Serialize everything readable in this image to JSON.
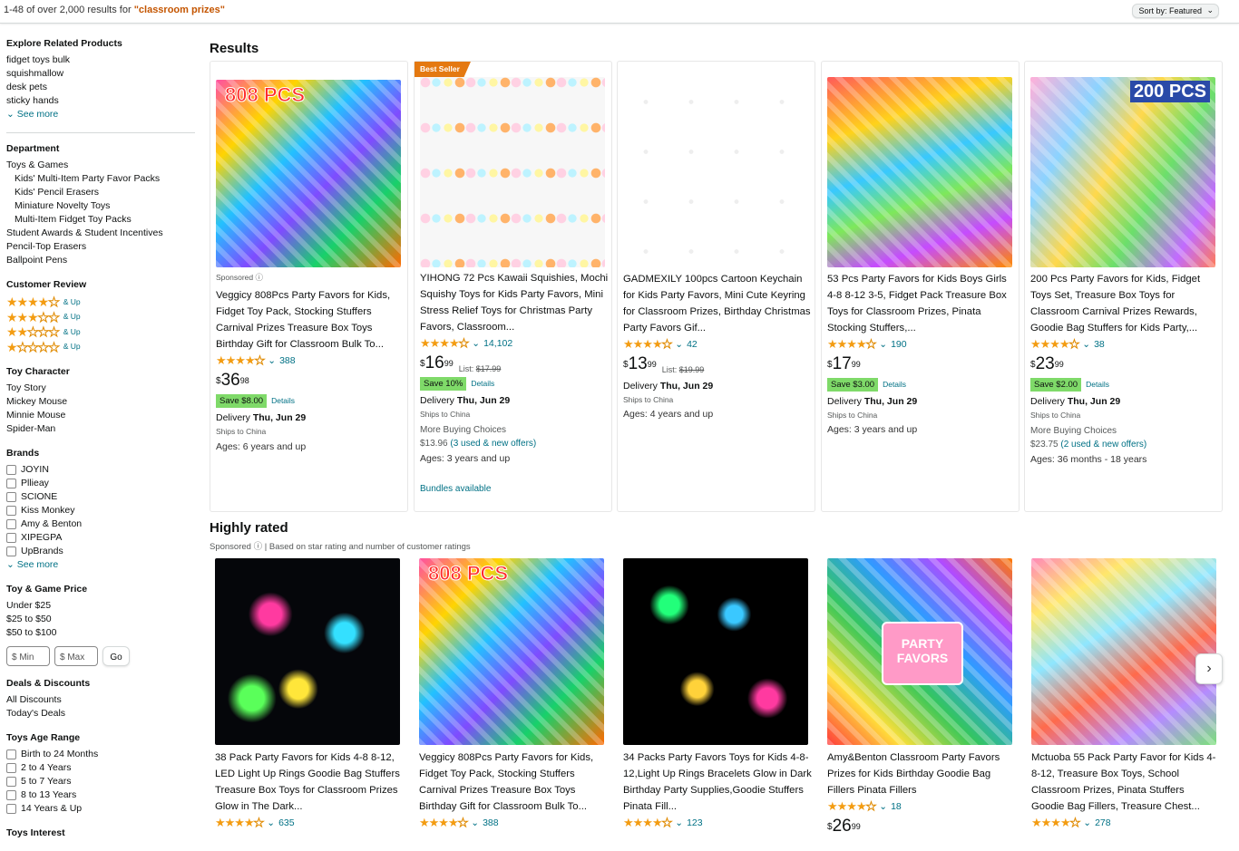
{
  "topbar": {
    "results_prefix": "1-48 of over 2,000 results for ",
    "query": "\"classroom prizes\"",
    "sort_label": "Sort by:",
    "sort_value": "Featured"
  },
  "sidebar": {
    "explore": {
      "heading": "Explore Related Products",
      "items": [
        "fidget toys bulk",
        "squishmallow",
        "desk pets",
        "sticky hands"
      ],
      "see_more": "See more"
    },
    "department": {
      "heading": "Department",
      "items": [
        "Toys & Games",
        "Kids' Multi-Item Party Favor Packs",
        "Kids' Pencil Erasers",
        "Miniature Novelty Toys",
        "Multi-Item Fidget Toy Packs",
        "Student Awards & Student Incentives",
        "Pencil-Top Erasers",
        "Ballpoint Pens"
      ]
    },
    "review": {
      "heading": "Customer Review",
      "up_label": "& Up",
      "rows": [
        4,
        3,
        2,
        1
      ]
    },
    "character": {
      "heading": "Toy Character",
      "items": [
        "Toy Story",
        "Mickey Mouse",
        "Minnie Mouse",
        "Spider-Man"
      ]
    },
    "brands": {
      "heading": "Brands",
      "items": [
        "JOYIN",
        "Pllieay",
        "SCIONE",
        "Kiss Monkey",
        "Amy & Benton",
        "XIPEGPA",
        "UpBrands"
      ],
      "see_more": "See more"
    },
    "price": {
      "heading": "Toy & Game Price",
      "items": [
        "Under $25",
        "$25 to $50",
        "$50 to $100"
      ],
      "min_placeholder": "$ Min",
      "max_placeholder": "$ Max",
      "go": "Go"
    },
    "deals": {
      "heading": "Deals & Discounts",
      "items": [
        "All Discounts",
        "Today's Deals"
      ]
    },
    "age": {
      "heading": "Toys Age Range",
      "items": [
        "Birth to 24 Months",
        "2 to 4 Years",
        "5 to 7 Years",
        "8 to 13 Years",
        "14 Years & Up"
      ]
    },
    "interest": {
      "heading": "Toys Interest"
    }
  },
  "results": {
    "heading": "Results",
    "cards": [
      {
        "sponsored": "Sponsored",
        "title": "Veggicy 808Pcs Party Favors for Kids, Fidget Toy Pack, Stocking Stuffers Carnival Prizes Treasure Box Toys Birthday Gift for Classroom Bulk To...",
        "stars": 4.5,
        "count": "388",
        "price_sym": "$",
        "price_whole": "36",
        "price_frac": "98",
        "save": "Save $8.00",
        "details": "Details",
        "delivery_label": "Delivery",
        "delivery_date": "Thu, Jun 29",
        "ships": "Ships to China",
        "ages": "Ages: 6 years and up",
        "image_text": "808 PCS"
      },
      {
        "badge": "Best Seller",
        "title": "YIHONG 72 Pcs Kawaii Squishies, Mochi Squishy Toys for Kids Party Favors, Mini Stress Relief Toys for Christmas Party Favors, Classroom...",
        "stars": 4.5,
        "count": "14,102",
        "price_sym": "$",
        "price_whole": "16",
        "price_frac": "99",
        "list_label": "List:",
        "list_price": "$17.99",
        "save": "Save 10%",
        "details": "Details",
        "delivery_label": "Delivery",
        "delivery_date": "Thu, Jun 29",
        "ships": "Ships to China",
        "more_buying": "More Buying Choices",
        "offer_price": "$13.96",
        "offers": "(3 used & new offers)",
        "ages": "Ages: 3 years and up",
        "bundles": "Bundles available"
      },
      {
        "title": "GADMEXILY 100pcs Cartoon Keychain for Kids Party Favors, Mini Cute Keyring for Classroom Prizes, Birthday Christmas Party Favors Gif...",
        "stars": 4.0,
        "count": "42",
        "price_sym": "$",
        "price_whole": "13",
        "price_frac": "99",
        "list_label": "List:",
        "list_price": "$19.99",
        "delivery_label": "Delivery",
        "delivery_date": "Thu, Jun 29",
        "ships": "Ships to China",
        "ages": "Ages: 4 years and up"
      },
      {
        "title": "53 Pcs Party Favors for Kids Boys Girls 4-8 8-12 3-5, Fidget Pack Treasure Box Toys for Classroom Prizes, Pinata Stocking Stuffers,...",
        "stars": 4.5,
        "count": "190",
        "price_sym": "$",
        "price_whole": "17",
        "price_frac": "99",
        "save": "Save $3.00",
        "details": "Details",
        "delivery_label": "Delivery",
        "delivery_date": "Thu, Jun 29",
        "ships": "Ships to China",
        "ages": "Ages: 3 years and up"
      },
      {
        "title": "200 Pcs Party Favors for Kids, Fidget Toys Set, Treasure Box Toys for Classroom Carnival Prizes Rewards, Goodie Bag Stuffers for Kids Party,...",
        "stars": 4.5,
        "count": "38",
        "price_sym": "$",
        "price_whole": "23",
        "price_frac": "99",
        "save": "Save $2.00",
        "details": "Details",
        "delivery_label": "Delivery",
        "delivery_date": "Thu, Jun 29",
        "ships": "Ships to China",
        "more_buying": "More Buying Choices",
        "offer_price": "$23.75",
        "offers": "(2 used & new offers)",
        "ages": "Ages: 36 months - 18 years",
        "image_text": "200 PCS"
      }
    ]
  },
  "highly_rated": {
    "heading": "Highly rated",
    "sponsored": "Sponsored",
    "note": "| Based on star rating and number of customer ratings",
    "cards": [
      {
        "title": "38 Pack Party Favors for Kids 4-8 8-12, LED Light Up Rings Goodie Bag Stuffers Treasure Box Toys for Classroom Prizes Glow in The Dark...",
        "stars": 4.5,
        "count": "635"
      },
      {
        "title": "Veggicy 808Pcs Party Favors for Kids, Fidget Toy Pack, Stocking Stuffers Carnival Prizes Treasure Box Toys Birthday Gift for Classroom Bulk To...",
        "stars": 4.5,
        "count": "388",
        "image_text": "808 PCS"
      },
      {
        "title": "34 Packs Party Favors Toys for Kids 4-8-12,Light Up Rings Bracelets Glow in Dark Birthday Party Supplies,Goodie Stuffers Pinata Fill...",
        "stars": 4.5,
        "count": "123"
      },
      {
        "title": "Amy&Benton Classroom Party Favors Prizes for Kids Birthday Goodie Bag Fillers Pinata Fillers",
        "stars": 4.5,
        "count": "18",
        "image_text": "PARTY FAVORS",
        "price_sym": "$",
        "price_whole": "26",
        "price_frac": "99"
      },
      {
        "title": "Mctuoba 55 Pack Party Favor for Kids 4-8-12, Treasure Box Toys, School Classroom Prizes, Pinata Stuffers Goodie Bag Fillers, Treasure Chest...",
        "stars": 4.5,
        "count": "278"
      }
    ]
  },
  "icons": {
    "chevron": "chevron-down-icon",
    "next": "chevron-right-icon",
    "info": "info-icon"
  }
}
